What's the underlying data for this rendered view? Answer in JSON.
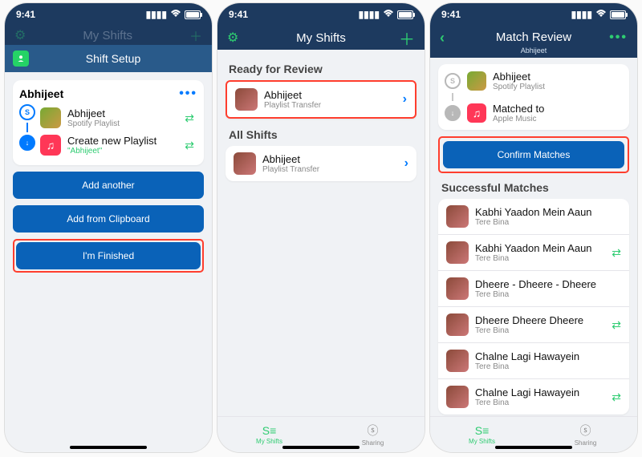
{
  "status": {
    "time": "9:41"
  },
  "screen1": {
    "dimmed_title": "My Shifts",
    "panel_title": "Shift Setup",
    "card_title": "Abhijeet",
    "source_name": "Abhijeet",
    "source_sub": "Spotify Playlist",
    "dest_name": "Create new Playlist",
    "dest_sub": "\"Abhijeet\"",
    "btn_add_another": "Add another",
    "btn_add_clipboard": "Add from Clipboard",
    "btn_finished": "I'm Finished"
  },
  "screen2": {
    "title": "My Shifts",
    "section_ready": "Ready for Review",
    "section_all": "All Shifts",
    "ready_item": {
      "title": "Abhijeet",
      "sub": "Playlist Transfer"
    },
    "all_item": {
      "title": "Abhijeet",
      "sub": "Playlist Transfer"
    },
    "tabs": {
      "shifts": "My Shifts",
      "sharing": "Sharing"
    }
  },
  "screen3": {
    "title": "Match Review",
    "subtitle": "Abhijeet",
    "src_name": "Abhijeet",
    "src_sub": "Spotify Playlist",
    "dst_name": "Matched to",
    "dst_sub": "Apple Music",
    "btn_confirm": "Confirm Matches",
    "section_success": "Successful Matches",
    "matches": [
      {
        "title": "Kabhi Yaadon Mein Aaun",
        "sub": "Tere Bina"
      },
      {
        "title": "Kabhi Yaadon Mein Aaun",
        "sub": "Tere Bina"
      },
      {
        "title": "Dheere - Dheere - Dheere",
        "sub": "Tere Bina"
      },
      {
        "title": "Dheere Dheere Dheere",
        "sub": "Tere Bina"
      },
      {
        "title": "Chalne Lagi Hawayein",
        "sub": "Tere Bina"
      },
      {
        "title": "Chalne Lagi Hawayein",
        "sub": "Tere Bina"
      }
    ],
    "tabs": {
      "shifts": "My Shifts",
      "sharing": "Sharing"
    }
  }
}
